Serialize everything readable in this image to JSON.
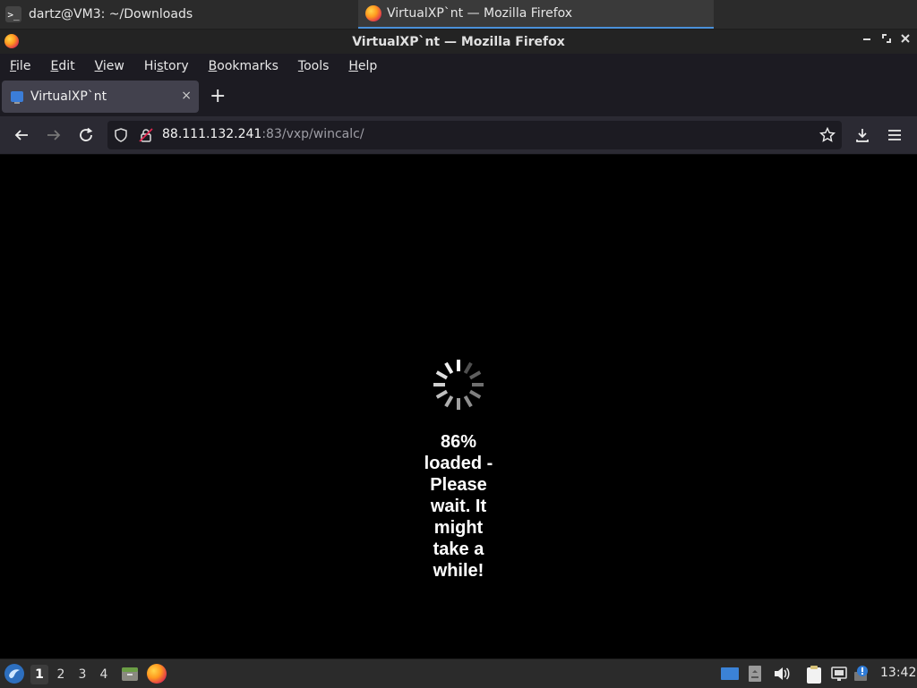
{
  "taskbar": {
    "terminal_title": "dartz@VM3: ~/Downloads",
    "terminal_icon_glyph": ">_",
    "firefox_title": "VirtualXP`nt — Mozilla Firefox"
  },
  "window": {
    "title": "VirtualXP`nt — Mozilla Firefox"
  },
  "menubar": {
    "items": [
      {
        "label": "File",
        "mnemonic": "F"
      },
      {
        "label": "Edit",
        "mnemonic": "E"
      },
      {
        "label": "View",
        "mnemonic": "V"
      },
      {
        "label": "History",
        "mnemonic": "s"
      },
      {
        "label": "Bookmarks",
        "mnemonic": "B"
      },
      {
        "label": "Tools",
        "mnemonic": "T"
      },
      {
        "label": "Help",
        "mnemonic": "H"
      }
    ]
  },
  "tabs": [
    {
      "label": "VirtualXP`nt",
      "active": true
    }
  ],
  "newtab_label": "+",
  "tab_close_label": "×",
  "navbar": {
    "url_host": "88.111.132.241",
    "url_path": ":83/vxp/wincalc/"
  },
  "content": {
    "loading_text": "86% loaded - Please wait. It might take a while!",
    "progress_percent": 86
  },
  "panel": {
    "workspaces": [
      "1",
      "2",
      "3",
      "4"
    ],
    "active_workspace": "1",
    "clock": "13:42"
  },
  "colors": {
    "accent": "#4a90d9",
    "page_background": "#000000",
    "toolbar_bg": "#2b2a33"
  }
}
